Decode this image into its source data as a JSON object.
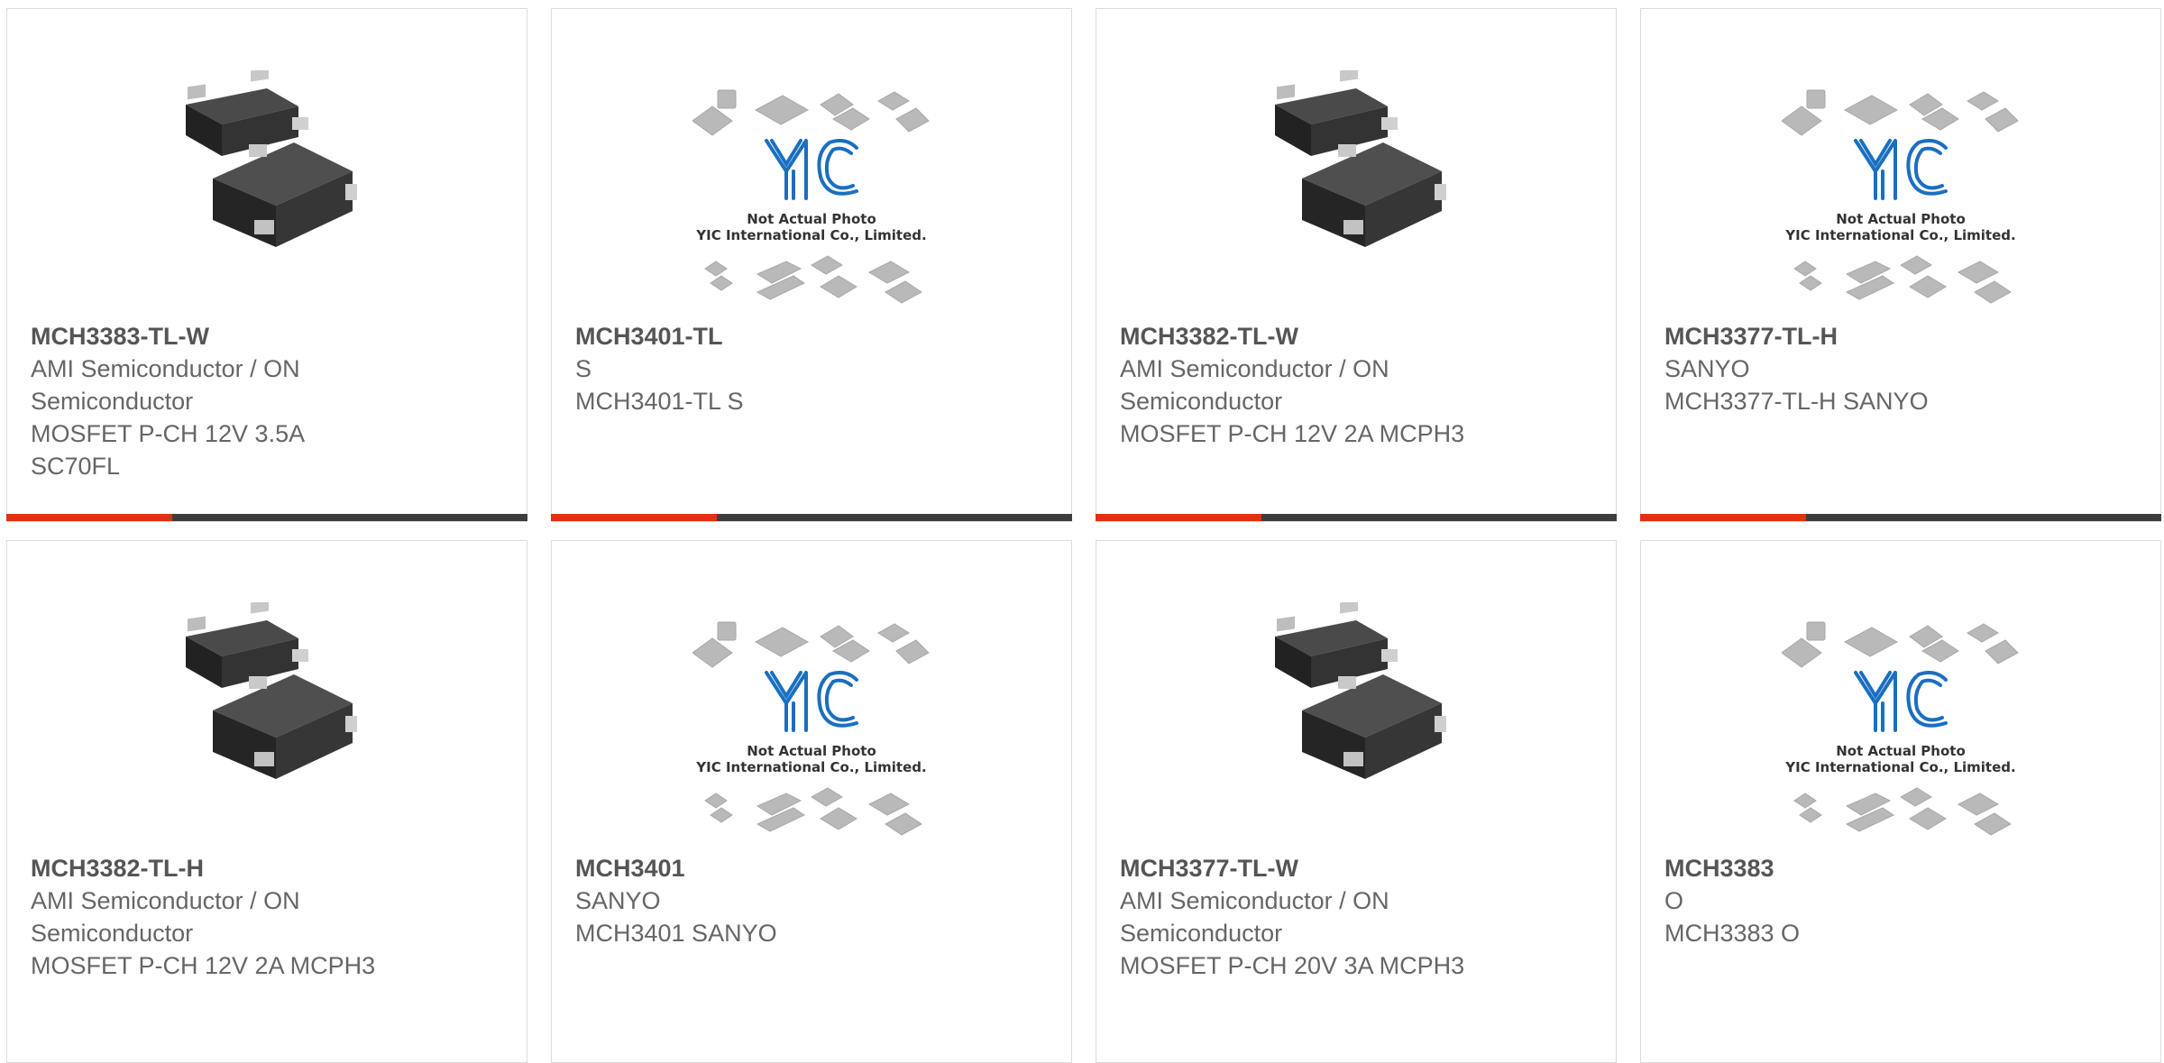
{
  "products": [
    {
      "part": "MCH3383-TL-W",
      "lines": [
        "AMI Semiconductor / ON",
        "Semiconductor",
        "MOSFET P-CH 12V 3.5A",
        "SC70FL"
      ],
      "image": "chip-package-photo",
      "accent_bar": true
    },
    {
      "part": "MCH3401-TL",
      "lines": [
        "S",
        "MCH3401-TL S"
      ],
      "image": "yic-placeholder",
      "accent_bar": true
    },
    {
      "part": "MCH3382-TL-W",
      "lines": [
        "AMI Semiconductor / ON",
        "Semiconductor",
        "MOSFET P-CH 12V 2A MCPH3"
      ],
      "image": "chip-package-photo",
      "accent_bar": true
    },
    {
      "part": "MCH3377-TL-H",
      "lines": [
        "SANYO",
        "MCH3377-TL-H SANYO"
      ],
      "image": "yic-placeholder",
      "accent_bar": true
    },
    {
      "part": "MCH3382-TL-H",
      "lines": [
        "AMI Semiconductor / ON",
        "Semiconductor",
        "MOSFET P-CH 12V 2A MCPH3"
      ],
      "image": "chip-package-photo",
      "accent_bar": false
    },
    {
      "part": "MCH3401",
      "lines": [
        "SANYO",
        "MCH3401 SANYO"
      ],
      "image": "yic-placeholder",
      "accent_bar": false
    },
    {
      "part": "MCH3377-TL-W",
      "lines": [
        "AMI Semiconductor / ON",
        "Semiconductor",
        "MOSFET P-CH 20V 3A MCPH3"
      ],
      "image": "chip-package-photo",
      "accent_bar": false
    },
    {
      "part": "MCH3383",
      "lines": [
        "O",
        "MCH3383 O"
      ],
      "image": "yic-placeholder",
      "accent_bar": false
    }
  ],
  "placeholder": {
    "logo_text": "YIC",
    "caption_line1": "Not Actual Photo",
    "caption_line2": "YIC International Co., Limited."
  },
  "colors": {
    "accent": "#e0320c",
    "bar": "#3d3d3d",
    "border": "#dcdcdc",
    "text": "#666666",
    "logo_blue": "#1a6fc0"
  }
}
